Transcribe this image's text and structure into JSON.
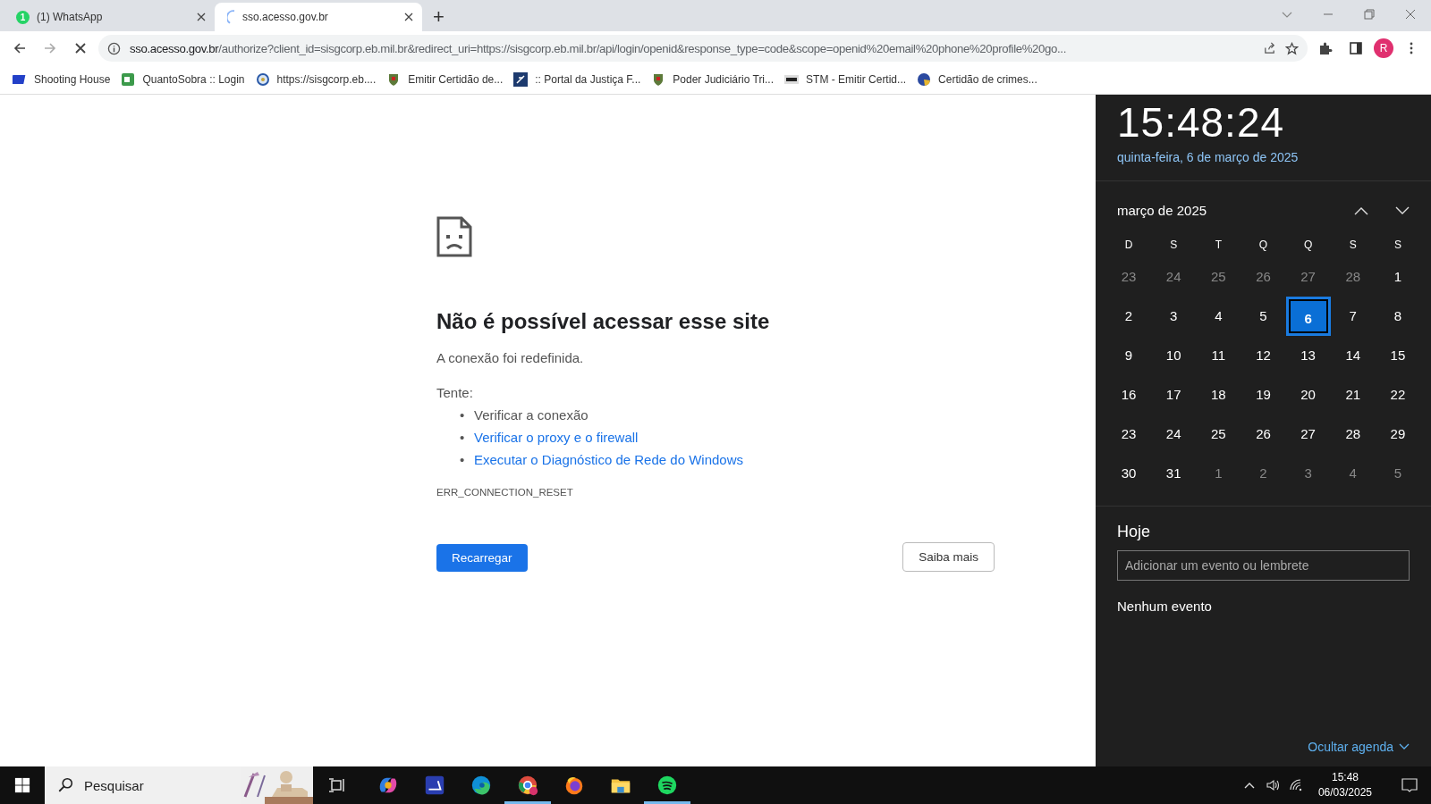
{
  "tabs": [
    {
      "title": "(1) WhatsApp",
      "badge": "1",
      "loading": false,
      "selected": false
    },
    {
      "title": "sso.acesso.gov.br",
      "loading": true,
      "selected": true
    }
  ],
  "new_tab": "+",
  "address_bar": {
    "host": "sso.acesso.gov.br",
    "path": "/authorize?client_id=sisgcorp.eb.mil.br&redirect_uri=https://sisgcorp.eb.mil.br/api/login/openid&response_type=code&scope=openid%20email%20phone%20profile%20go...",
    "avatar": "R"
  },
  "bookmarks": [
    {
      "label": "Shooting House",
      "kind": "sh"
    },
    {
      "label": "QuantoSobra :: Login",
      "kind": "qs"
    },
    {
      "label": "https://sisgcorp.eb....",
      "kind": "globe"
    },
    {
      "label": "Emitir Certidão de...",
      "kind": "crest"
    },
    {
      "label": ":: Portal da Justiça F...",
      "kind": "justice"
    },
    {
      "label": "Poder Judiciário Tri...",
      "kind": "crest"
    },
    {
      "label": "STM - Emitir Certid...",
      "kind": "stm"
    },
    {
      "label": "Certidão de crimes...",
      "kind": "globe2"
    }
  ],
  "error_page": {
    "title": "Não é possível acessar esse site",
    "message": "A conexão foi redefinida.",
    "try_label": "Tente:",
    "suggestions": [
      {
        "marker": "•",
        "text": "Verificar a conexão",
        "link": false
      },
      {
        "marker": "•",
        "text": "Verificar o proxy e o firewall",
        "link": true
      },
      {
        "marker": "•",
        "text": "Executar o Diagnóstico de Rede do Windows",
        "link": true
      }
    ],
    "code": "ERR_CONNECTION_RESET",
    "reload_button": "Recarregar",
    "details_button": "Saiba mais"
  },
  "clock_flyout": {
    "time": "15:48:24",
    "date": "quinta-feira, 6 de março de 2025",
    "month": "março de 2025",
    "weekdays": [
      "D",
      "S",
      "T",
      "Q",
      "Q",
      "S",
      "S"
    ],
    "weeks": [
      [
        {
          "day": "23",
          "current_month": false,
          "selected": false
        },
        {
          "day": "24",
          "current_month": false,
          "selected": false
        },
        {
          "day": "25",
          "current_month": false,
          "selected": false
        },
        {
          "day": "26",
          "current_month": false,
          "selected": false
        },
        {
          "day": "27",
          "current_month": false,
          "selected": false
        },
        {
          "day": "28",
          "current_month": false,
          "selected": false
        },
        {
          "day": "1",
          "current_month": true,
          "selected": false
        }
      ],
      [
        {
          "day": "2",
          "current_month": true,
          "selected": false
        },
        {
          "day": "3",
          "current_month": true,
          "selected": false
        },
        {
          "day": "4",
          "current_month": true,
          "selected": false
        },
        {
          "day": "5",
          "current_month": true,
          "selected": false
        },
        {
          "day": "6",
          "current_month": true,
          "selected": true
        },
        {
          "day": "7",
          "current_month": true,
          "selected": false
        },
        {
          "day": "8",
          "current_month": true,
          "selected": false
        }
      ],
      [
        {
          "day": "9",
          "current_month": true,
          "selected": false
        },
        {
          "day": "10",
          "current_month": true,
          "selected": false
        },
        {
          "day": "11",
          "current_month": true,
          "selected": false
        },
        {
          "day": "12",
          "current_month": true,
          "selected": false
        },
        {
          "day": "13",
          "current_month": true,
          "selected": false
        },
        {
          "day": "14",
          "current_month": true,
          "selected": false
        },
        {
          "day": "15",
          "current_month": true,
          "selected": false
        }
      ],
      [
        {
          "day": "16",
          "current_month": true,
          "selected": false
        },
        {
          "day": "17",
          "current_month": true,
          "selected": false
        },
        {
          "day": "18",
          "current_month": true,
          "selected": false
        },
        {
          "day": "19",
          "current_month": true,
          "selected": false
        },
        {
          "day": "20",
          "current_month": true,
          "selected": false
        },
        {
          "day": "21",
          "current_month": true,
          "selected": false
        },
        {
          "day": "22",
          "current_month": true,
          "selected": false
        }
      ],
      [
        {
          "day": "23",
          "current_month": true,
          "selected": false
        },
        {
          "day": "24",
          "current_month": true,
          "selected": false
        },
        {
          "day": "25",
          "current_month": true,
          "selected": false
        },
        {
          "day": "26",
          "current_month": true,
          "selected": false
        },
        {
          "day": "27",
          "current_month": true,
          "selected": false
        },
        {
          "day": "28",
          "current_month": true,
          "selected": false
        },
        {
          "day": "29",
          "current_month": true,
          "selected": false
        }
      ],
      [
        {
          "day": "30",
          "current_month": true,
          "selected": false
        },
        {
          "day": "31",
          "current_month": true,
          "selected": false
        },
        {
          "day": "1",
          "current_month": false,
          "selected": false
        },
        {
          "day": "2",
          "current_month": false,
          "selected": false
        },
        {
          "day": "3",
          "current_month": false,
          "selected": false
        },
        {
          "day": "4",
          "current_month": false,
          "selected": false
        },
        {
          "day": "5",
          "current_month": false,
          "selected": false
        }
      ]
    ],
    "agenda_title": "Hoje",
    "event_placeholder": "Adicionar um evento ou lembrete",
    "no_events": "Nenhum evento",
    "hide_agenda": "Ocultar agenda"
  },
  "taskbar": {
    "search_placeholder": "Pesquisar",
    "apps": [
      {
        "kind": "copilot",
        "active": false
      },
      {
        "kind": "scanner",
        "active": false
      },
      {
        "kind": "edge",
        "active": false
      },
      {
        "kind": "chrome",
        "active": true
      },
      {
        "kind": "firefox",
        "active": false
      },
      {
        "kind": "explorer",
        "active": false
      },
      {
        "kind": "spotify",
        "active": true
      }
    ],
    "time": "15:48",
    "date": "06/03/2025"
  }
}
